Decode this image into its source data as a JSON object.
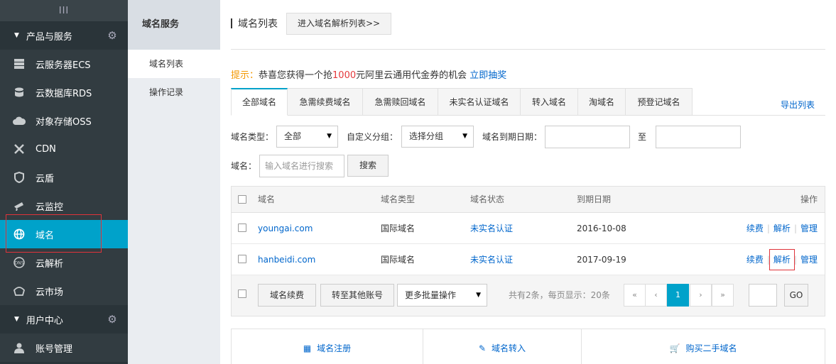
{
  "sidebar": {
    "collapse_glyph": "III",
    "section_products": "产品与服务",
    "section_user": "用户中心",
    "items": [
      {
        "label": "云服务器ECS",
        "icon": "server-icon"
      },
      {
        "label": "云数据库RDS",
        "icon": "database-icon"
      },
      {
        "label": "对象存储OSS",
        "icon": "cloud-storage-icon"
      },
      {
        "label": "CDN",
        "icon": "cdn-icon"
      },
      {
        "label": "云盾",
        "icon": "shield-icon"
      },
      {
        "label": "云监控",
        "icon": "monitor-icon"
      },
      {
        "label": "域名",
        "icon": "globe-icon",
        "active": true
      },
      {
        "label": "云解析",
        "icon": "dns-icon"
      },
      {
        "label": "云市场",
        "icon": "market-icon"
      }
    ],
    "user_items": [
      {
        "label": "账号管理",
        "icon": "user-icon"
      }
    ]
  },
  "submenu": {
    "title": "域名服务",
    "items": [
      "域名列表",
      "操作记录"
    ]
  },
  "header": {
    "title": "域名列表",
    "dns_button": "进入域名解析列表>>"
  },
  "tip": {
    "label": "提示：",
    "text_before": "恭喜您获得一个抢",
    "amount": "1000",
    "text_after": "元阿里云通用代金券的机会",
    "link": "立即抽奖"
  },
  "tabs": [
    "全部域名",
    "急需续费域名",
    "急需赎回域名",
    "未实名认证域名",
    "转入域名",
    "淘域名",
    "预登记域名"
  ],
  "export_label": "导出列表",
  "filters": {
    "type_label": "域名类型：",
    "type_value": "全部",
    "group_label": "自定义分组：",
    "group_value": "选择分组",
    "expire_label": "域名到期日期：",
    "to_label": "至",
    "domain_label": "域名：",
    "domain_placeholder": "输入域名进行搜索",
    "search_button": "搜索"
  },
  "table": {
    "columns": [
      "域名",
      "域名类型",
      "域名状态",
      "到期日期",
      "操作"
    ],
    "rows": [
      {
        "domain": "youngai.com",
        "type": "国际域名",
        "status": "未实名认证",
        "expire": "2016-10-08"
      },
      {
        "domain": "hanbeidi.com",
        "type": "国际域名",
        "status": "未实名认证",
        "expire": "2017-09-19"
      }
    ],
    "ops": [
      "续费",
      "解析",
      "管理"
    ]
  },
  "footer": {
    "renew_button": "域名续费",
    "transfer_button": "转至其他账号",
    "batch_select": "更多批量操作",
    "summary": "共有2条，每页显示：20条",
    "pages": [
      "«",
      "‹",
      "1",
      "›",
      "»"
    ],
    "go_button": "GO"
  },
  "bottom": {
    "register": "域名注册",
    "transfer_in": "域名转入",
    "buy_second": "购买二手域名"
  },
  "colors": {
    "sidebar_bg": "#2a3439",
    "accent": "#00a2ca",
    "link": "#0066cc",
    "highlight_box": "#e0333a"
  }
}
